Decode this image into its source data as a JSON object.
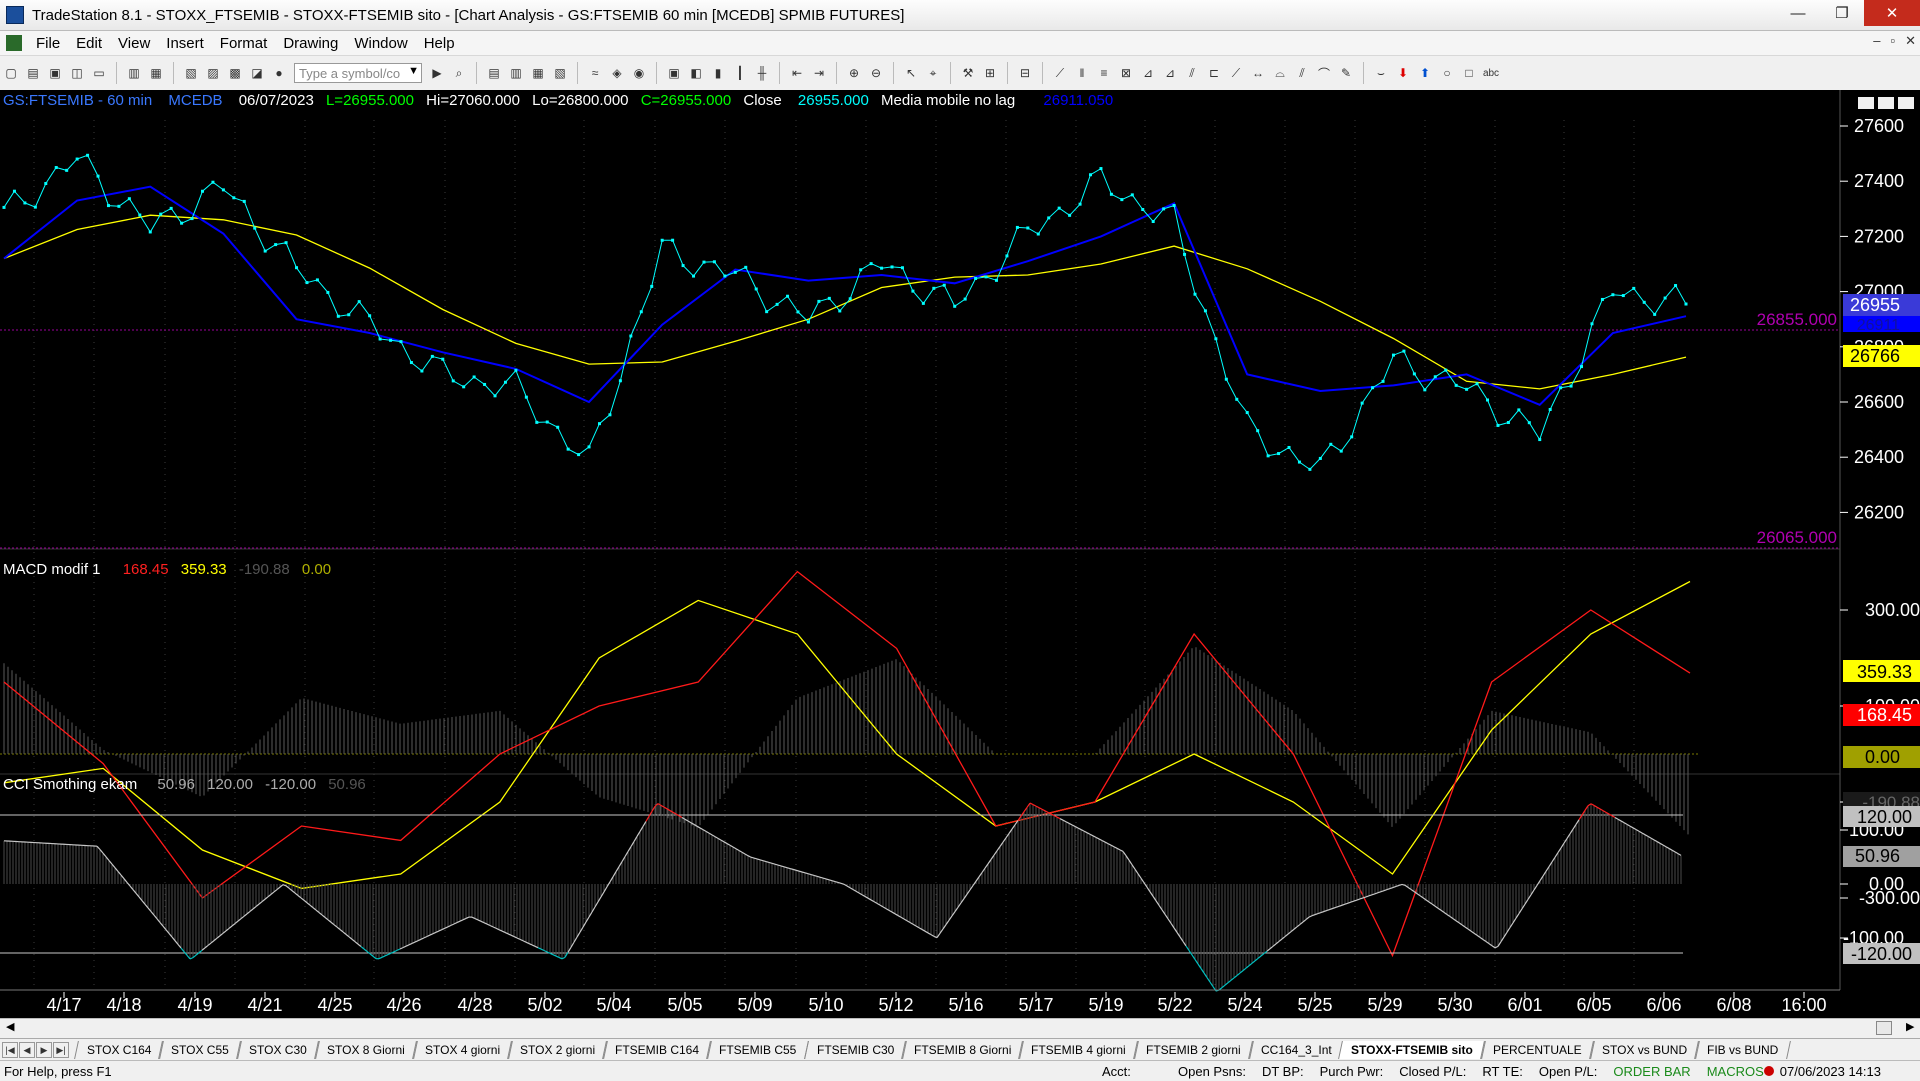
{
  "window": {
    "title": "TradeStation 8.1 - STOXX_FTSEMIB - STOXX-FTSEMIB sito - [Chart Analysis - GS:FTSEMIB  60 min  [MCEDB] SPMIB FUTURES]",
    "minimize": "—",
    "maximize": "❐",
    "close": "✕"
  },
  "menu": {
    "items": [
      "File",
      "Edit",
      "View",
      "Insert",
      "Format",
      "Drawing",
      "Window",
      "Help"
    ],
    "mdi_minimize": "–",
    "mdi_restore": "▫",
    "mdi_close": "✕"
  },
  "toolbar": {
    "symbol_placeholder": "Type a symbol/co"
  },
  "price_pane": {
    "header": {
      "symbol": "GS:FTSEMIB - 60 min",
      "ticker": "MCEDB",
      "date": "06/07/2023",
      "last": "L=26955.000",
      "high": "Hi=27060.000",
      "low": "Lo=26800.000",
      "close": "C=26955.000",
      "close_label": "Close",
      "close_value": "26955.000",
      "ma_label": "Media mobile no lag",
      "ma_value": "26911.050"
    },
    "axis_ticks": [
      "27600",
      "27400",
      "27200",
      "27000",
      "26800",
      "26600",
      "26400",
      "26200"
    ],
    "line_labels": [
      "26855.000",
      "26065.000"
    ],
    "badges": [
      "26955",
      "26911",
      "26766"
    ],
    "colors": {
      "price": "#00ffff",
      "ma_fast": "#0000ff",
      "ma_slow": "#ffff00",
      "level": "#b000b0"
    }
  },
  "macd_pane": {
    "header": {
      "name": "MACD modif 1",
      "v1": "168.45",
      "v2": "359.33",
      "v3": "-190.88",
      "v4": "0.00"
    },
    "axis_ticks": [
      "300.00",
      "100.00",
      "-100.00",
      "-300.00"
    ],
    "badges": [
      "359.33",
      "168.45",
      "0.00",
      "-190.88"
    ]
  },
  "cci_pane": {
    "header": {
      "name": "CCI Smothing ekam",
      "v1": "50.96",
      "v2": "120.00",
      "v3": "-120.00",
      "v4": "50.96"
    },
    "axis_ticks": [
      "100.00",
      "0.00",
      "-100.00"
    ],
    "badges": [
      "120.00",
      "50.96",
      "-120.00"
    ]
  },
  "chart_data": [
    {
      "type": "line",
      "title": "GS:FTSEMIB - 60 min",
      "x": [
        "4/17",
        "4/18",
        "4/19",
        "4/21",
        "4/25",
        "4/26",
        "4/28",
        "5/02",
        "5/04",
        "5/05",
        "5/09",
        "5/10",
        "5/12",
        "5/16",
        "5/17",
        "5/19",
        "5/22",
        "5/24",
        "5/25",
        "5/29",
        "5/30",
        "6/01",
        "6/05",
        "6/06",
        "6/08",
        "16:00"
      ],
      "series": [
        {
          "name": "Close",
          "values": [
            27280,
            27480,
            27230,
            27380,
            27080,
            26880,
            26700,
            26650,
            26380,
            27150,
            27060,
            26900,
            27100,
            26950,
            27210,
            27400,
            27250,
            26500,
            26350,
            26750,
            26650,
            26480,
            27000,
            26955
          ]
        },
        {
          "name": "Media mobile no lag",
          "values": [
            27120,
            27330,
            27380,
            27210,
            26900,
            26850,
            26780,
            26720,
            26600,
            26880,
            27080,
            27040,
            27060,
            27030,
            27110,
            27200,
            27320,
            26700,
            26640,
            26660,
            26700,
            26590,
            26850,
            26911
          ]
        }
      ],
      "ylim": [
        26000,
        27680
      ]
    },
    {
      "type": "line",
      "title": "MACD modif 1",
      "series": [
        {
          "name": "MACD",
          "values": [
            150,
            -20,
            -300,
            -150,
            -180,
            0,
            100,
            150,
            380,
            220,
            -150,
            -100,
            250,
            0,
            -420,
            150,
            300,
            168.45
          ]
        },
        {
          "name": "Signal",
          "values": [
            -60,
            -30,
            -200,
            -280,
            -250,
            -100,
            200,
            320,
            250,
            0,
            -150,
            -100,
            0,
            -100,
            -250,
            50,
            250,
            359.33
          ]
        }
      ],
      "ylim": [
        -450,
        400
      ]
    },
    {
      "type": "line",
      "title": "CCI Smothing ekam",
      "series": [
        {
          "name": "CCI",
          "values": [
            80,
            70,
            -140,
            0,
            -140,
            -60,
            -140,
            150,
            50,
            0,
            -100,
            150,
            60,
            -200,
            -60,
            0,
            -120,
            150,
            50.96
          ]
        }
      ],
      "ylim": [
        -200,
        160
      ]
    }
  ],
  "xaxis_labels": [
    "4/17",
    "4/18",
    "4/19",
    "4/21",
    "4/25",
    "4/26",
    "4/28",
    "5/02",
    "5/04",
    "5/05",
    "5/09",
    "5/10",
    "5/12",
    "5/16",
    "5/17",
    "5/19",
    "5/22",
    "5/24",
    "5/25",
    "5/29",
    "5/30",
    "6/01",
    "6/05",
    "6/06",
    "6/08",
    "16:00"
  ],
  "tabs": [
    "STOX C164",
    "STOX C55",
    "STOX  C30",
    "STOX  8 Giorni",
    "STOX 4 giorni",
    "STOX  2 giorni",
    "FTSEMIB C164",
    "FTSEMIB C55",
    "FTSEMIB C30",
    "FTSEMIB  8 Giorni",
    "FTSEMIB  4 giorni",
    "FTSEMIB  2 giorni",
    "CC164_3_Int",
    "STOXX-FTSEMIB sito",
    "PERCENTUALE",
    "STOX vs BUND",
    "FIB vs BUND"
  ],
  "active_tab": "STOXX-FTSEMIB sito",
  "status": {
    "help": "For Help, press F1",
    "acct": "Acct:",
    "open_psns": "Open Psns:",
    "dt_bp": "DT BP:",
    "purch_pwr": "Purch Pwr:",
    "closed_pl": "Closed P/L:",
    "rt_te": "RT TE:",
    "open_pl": "Open P/L:",
    "order_bar": "ORDER BAR",
    "macros": "MACROS",
    "datetime": "07/06/2023 14:13"
  }
}
